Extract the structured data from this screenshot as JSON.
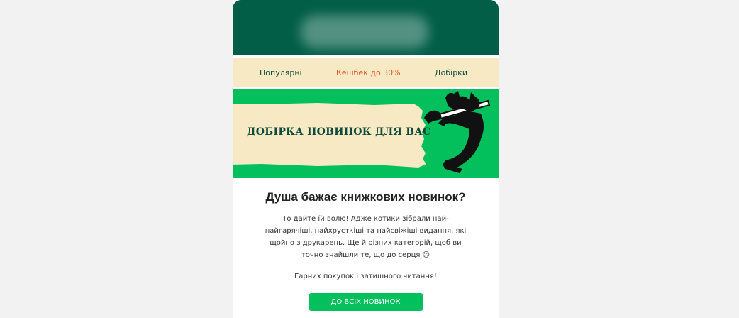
{
  "nav": {
    "popular": "Популярні",
    "cashback": "Кешбек до 30%",
    "collections": "Добірки"
  },
  "banner": {
    "title": "ДОБІРКА НОВИНОК ДЛЯ ВАС"
  },
  "content": {
    "heading": "Душа бажає книжкових новинок?",
    "body": "То дайте їй волю! Адже котики зібрали най-найгарячіші, найхрусткіші та найсвіжіші видання, які щойно з друкарень. Ще й різних категорій, щоб ви точно знайшли те, що до серця 😊",
    "closing": "Гарних покупок і затишного читання!",
    "cta_label": "ДО ВСІХ НОВИНОК"
  },
  "colors": {
    "header_bg": "#025e47",
    "nav_bg": "#f6e9c3",
    "accent_green": "#03c05d",
    "cashback_orange": "#e1542d"
  }
}
